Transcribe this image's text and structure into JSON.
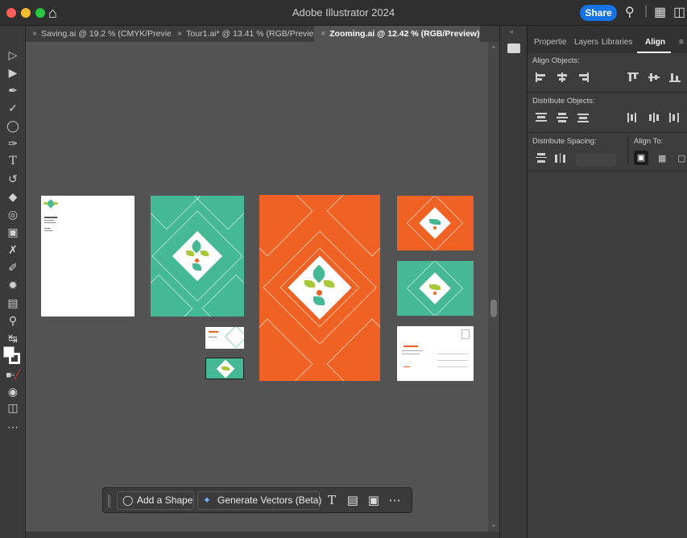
{
  "window": {
    "title": "Adobe Illustrator 2024",
    "share_label": "Share"
  },
  "tabs": [
    {
      "label": "Saving.ai @ 19.2 % (CMYK/Previe..."
    },
    {
      "label": "Tour1.ai* @ 13.41 % (RGB/Previe..."
    },
    {
      "label": "Zooming.ai @ 12.42 % (RGB/Preview)",
      "active": true
    }
  ],
  "panel": {
    "tabs": [
      "Propertie",
      "Layers",
      "Libraries",
      "Align"
    ],
    "active_tab": "Align",
    "sections": {
      "align_objects": "Align Objects:",
      "distribute_objects": "Distribute Objects:",
      "distribute_spacing": "Distribute Spacing:",
      "align_to": "Align To:"
    }
  },
  "context_bar": {
    "add_shape": "Add a Shape",
    "generate_vectors": "Generate Vectors (Beta)"
  },
  "colors": {
    "orange": "#ef6224",
    "green": "#45b993",
    "canvas": "#535353",
    "accent": "#1473e6"
  }
}
